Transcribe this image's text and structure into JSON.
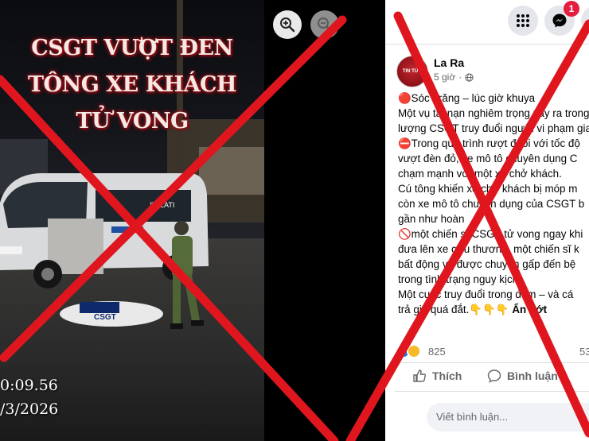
{
  "photo": {
    "headline_lines": [
      "CSGT VƯỢT ĐEN",
      "TÔNG XE KHÁCH",
      "TỬ VONG"
    ],
    "timestamp_lines": [
      "0:09.56",
      "/3/2026"
    ],
    "van_brand": "SOLATI",
    "moto_label": "CSGT"
  },
  "viewer_controls": {
    "zoom_in_icon": "zoom-in-icon",
    "zoom_out_icon": "zoom-out-icon"
  },
  "topbar": {
    "notification_count": "1",
    "icons": [
      "grid-menu-icon",
      "messenger-icon"
    ]
  },
  "post": {
    "author": "La Ra",
    "time": "5 giờ",
    "lines": [
      "🔴Sóc Trăng – lúc giờ khuya",
      "Một vụ tai nạn nghiêm trọng xảy ra trong",
      "lượng CSGT truy đuổi người vi phạm giao",
      "⛔Trong quá trình rượt đuổi với tốc độ",
      "vượt đèn đỏ, xe mô tô chuyên dụng C",
      "chạm mạnh với một xe chở khách.",
      "Cú tông khiến xe chở khách bị móp m",
      "còn xe mô tô chuyên dụng của CSGT b",
      "gần như hoàn",
      "🚫một chiến sĩ CSGT tử vong ngay khi",
      "đưa lên xe cứu thương, một chiến sĩ k",
      "bất động và được chuyển gấp đến bệ",
      "trong tình trạng nguy kịch.",
      "Một cuộc truy đuổi trong đêm – và cá",
      "trả giá quá đắt.👇👇👇"
    ],
    "see_less": "Ẩn bớt",
    "reaction_count": "825",
    "comment_count": "53",
    "like_label": "Thích",
    "comment_label": "Bình luận",
    "comment_placeholder": "Viết bình luận..."
  },
  "overlay": {
    "x_color": "#e0161f"
  }
}
